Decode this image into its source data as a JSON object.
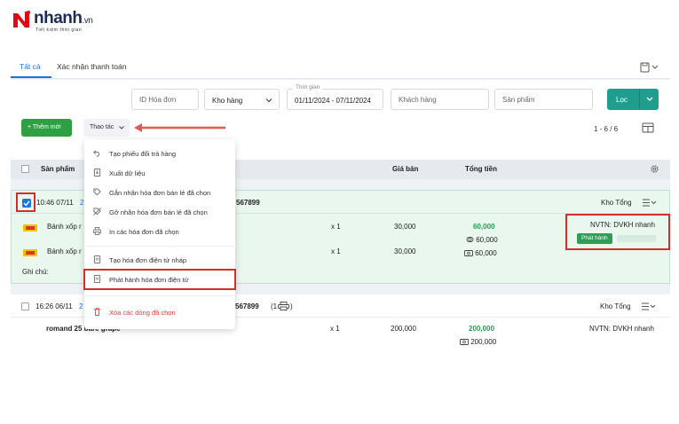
{
  "brand": {
    "name": "nhanh",
    "suffix": ".vn",
    "tagline": "Tiết kiệm thời gian",
    "logo_color": "#e30613"
  },
  "tabs": [
    {
      "label": "Tất cả"
    },
    {
      "label": "Xác nhận thanh toán"
    }
  ],
  "filters": {
    "invoice_id_placeholder": "ID Hóa đơn",
    "warehouse_select": "Kho hàng",
    "time_label": "Thời gian",
    "time_value": "01/11/2024 - 07/11/2024",
    "customer_placeholder": "Khách hàng",
    "product_placeholder": "Sản phẩm",
    "filter_button": "Lọc"
  },
  "toolbar": {
    "add_button": "+ Thêm mới",
    "actions_button": "Thao tác",
    "page_range": "1 - 6 / 6"
  },
  "table_header": {
    "product": "Sản phẩm",
    "price": "Giá bán",
    "total": "Tổng tiền"
  },
  "actions_menu": [
    {
      "icon": "return-icon",
      "label": "Tạo phiếu đổi trả hàng"
    },
    {
      "icon": "export-icon",
      "label": "Xuất dữ liệu"
    },
    {
      "icon": "tag-icon",
      "label": "Gắn nhãn hóa đơn bán lẻ đã chọn"
    },
    {
      "icon": "untag-icon",
      "label": "Gỡ nhãn hóa đơn bán lẻ đã chọn"
    },
    {
      "icon": "print-icon",
      "label": "In các hóa đơn đã chọn"
    },
    {
      "icon": "draft-invoice-icon",
      "label": "Tạo hóa đơn điện tử nháp"
    },
    {
      "icon": "issue-invoice-icon",
      "label": "Phát hành hóa đơn điện tử"
    },
    {
      "icon": "trash-icon",
      "label": "Xóa các dòng đã chọn"
    }
  ],
  "orders": [
    {
      "time": "10:46 07/11",
      "id_prefix": "2",
      "phone_partial": "567899",
      "warehouse": "Kho Tổng",
      "items": [
        {
          "name": "Bánh xốp r",
          "qty": "x 1",
          "price": "30,000"
        },
        {
          "name": "Bánh xốp r",
          "qty": "x 1",
          "price": "30,000"
        }
      ],
      "total": "60,000",
      "payment_1": "60,000",
      "payment_2": "60,000",
      "note_label": "Ghi chú:",
      "staff": "NVTN: DVKH nhanh",
      "status_badge": "Phát hành"
    },
    {
      "time": "16:26 06/11",
      "id_prefix": "2",
      "phone_partial": "567899",
      "count": "(1",
      "warehouse": "Kho Tổng",
      "items": [
        {
          "name": "romand 25 bare grape",
          "qty": "x 1",
          "price": "200,000"
        }
      ],
      "total": "200,000",
      "payment_1": "200,000",
      "staff": "NVTN: DVKH nhanh"
    }
  ]
}
